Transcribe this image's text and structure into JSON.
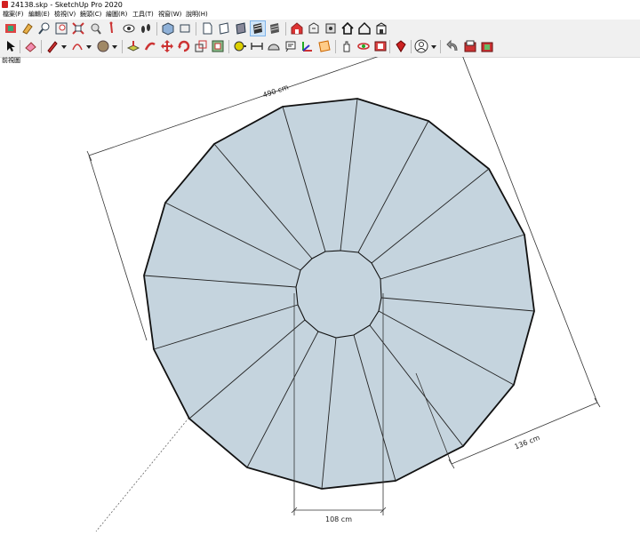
{
  "app": {
    "window_title": "24138.skp - SketchUp Pro 2020"
  },
  "menu": [
    {
      "label": "檔案(F)"
    },
    {
      "label": "編輯(E)"
    },
    {
      "label": "檢視(V)"
    },
    {
      "label": "鏡頭(C)"
    },
    {
      "label": "繪圖(R)"
    },
    {
      "label": "工具(T)"
    },
    {
      "label": "視窗(W)"
    },
    {
      "label": "說明(H)"
    }
  ],
  "toolbar1": {
    "icons": [
      "component-icon",
      "paint-icon",
      "zoom-icon",
      "zoom-extents-icon",
      "zoom-window-icon",
      "orbit-zoom-icon",
      "walk-icon",
      "look-around-icon",
      "eye-icon",
      "footprint-icon",
      "iso-view-icon",
      "top-view-icon",
      "front-view-icon",
      "right-view-icon",
      "back-view-icon",
      "left-view-icon",
      "xray-icon",
      "wireframe-icon",
      "hidden-line-icon",
      "shaded-icon",
      "textured-icon",
      "monochrome-icon",
      "warehouse-icon",
      "share-model-icon",
      "extension-icon",
      "home-icon",
      "outline-house-icon",
      "house-building-icon"
    ],
    "active": "shaded-icon"
  },
  "toolbar2": {
    "icons": [
      "select-icon",
      "eraser-icon",
      "pencil-icon",
      "arc-icon",
      "circle-shape-icon",
      "push-pull-icon",
      "follow-me-icon",
      "move-icon",
      "rotate-icon",
      "scale-icon",
      "offset-icon",
      "tape-measure-icon",
      "dimension-icon",
      "protractor-icon",
      "text-icon",
      "axes-icon",
      "section-plane-icon",
      "pan-icon",
      "orbit-icon",
      "zoom-extents-2-icon",
      "warehouse-2-icon",
      "ruby-icon",
      "user-icon",
      "undo-icon",
      "sandbox-icon",
      "layout-icon"
    ]
  },
  "viewport": {
    "scene_label": "前視圖",
    "dimensions": {
      "overall": "490 cm",
      "outer_radius": "136 cm",
      "inner": "108 cm"
    },
    "colors": {
      "face_fill": "#c5d4de",
      "edge": "#111111",
      "dimension_line": "#333333"
    }
  }
}
